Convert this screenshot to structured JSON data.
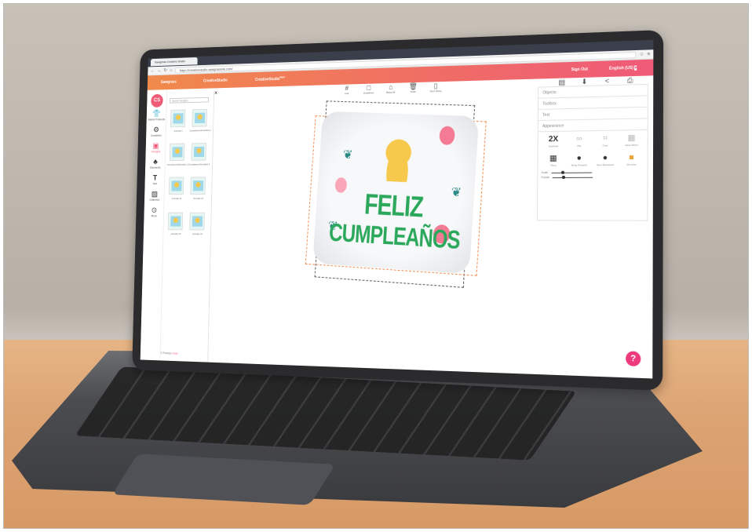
{
  "browser": {
    "tab_title": "Sawgrass Creative Studio",
    "url": "https://creativestudio.sawgrassink.com/"
  },
  "appnav": {
    "brand": "Sawgrass",
    "product1": "CreativeStudio",
    "product2": "CreativeStudio",
    "product2_badge": "New",
    "sign_out": "Sign Out",
    "language": "English (US)"
  },
  "sidebar": {
    "logo": "CS",
    "items": [
      {
        "label": "Blank Products",
        "icon": "shirt-icon"
      },
      {
        "label": "Creations",
        "icon": "palette-icon"
      },
      {
        "label": "Designs",
        "icon": "design-icon"
      },
      {
        "label": "Elements",
        "icon": "shapes-icon"
      },
      {
        "label": "Text",
        "icon": "text-icon"
      },
      {
        "label": "Galleries",
        "icon": "image-icon"
      },
      {
        "label": "More",
        "icon": "more-icon"
      }
    ]
  },
  "design_panel": {
    "search_placeholder": "Search designs...",
    "thumbs": [
      {
        "label": "Animals 1"
      },
      {
        "label": "CumpleanosSencillos 1"
      },
      {
        "label": "CumpleanosSencillos 2"
      },
      {
        "label": "CumpleanosSencillos 3"
      },
      {
        "label": "Animals 11"
      },
      {
        "label": "Animals 12"
      },
      {
        "label": "Animals 13"
      },
      {
        "label": "Animals 14"
      }
    ],
    "footer_prefix": "1 Photo(s)",
    "footer_link": "Clear"
  },
  "toolbar": {
    "items": [
      {
        "label": "Grid",
        "icon": "grid-icon"
      },
      {
        "label": "Guidelines",
        "icon": "guidelines-icon"
      },
      {
        "label": "Bleed All",
        "icon": "bleed-icon"
      },
      {
        "label": "Trash",
        "icon": "trash-icon"
      },
      {
        "label": "Don't Show",
        "icon": "page-icon"
      }
    ],
    "right": [
      {
        "label": "Save",
        "icon": "save-icon"
      },
      {
        "label": "Download",
        "icon": "download-icon"
      },
      {
        "label": "Share",
        "icon": "share-icon"
      },
      {
        "label": "Print",
        "icon": "print-icon"
      }
    ]
  },
  "canvas": {
    "headline1": "FELIZ",
    "headline2": "CUMPLEAÑOS"
  },
  "right_panel": {
    "objects": "Objects",
    "toolbox": "Toolbox",
    "text": "Text",
    "appearance": "Appearance",
    "tools_row1": [
      {
        "glyph": "2X",
        "label": "Duplicate"
      },
      {
        "glyph": "∞",
        "label": "Flip"
      },
      {
        "glyph": "⌗",
        "label": "Crop"
      },
      {
        "glyph": "▦",
        "label": "Clear Mirror"
      }
    ],
    "tools_row2": [
      {
        "glyph": "▦",
        "label": "Tiling"
      },
      {
        "glyph": "●",
        "label": "Bring Forward"
      },
      {
        "glyph": "●",
        "label": "Send Backward"
      },
      {
        "glyph": "■",
        "label": "Fill Color"
      }
    ],
    "scale_label": "Scale",
    "rotate_label": "Rotate"
  },
  "help": "?",
  "colors": {
    "accent": "#ef5a77",
    "accent2": "#f08a4b",
    "headline": "#2ca85c"
  }
}
